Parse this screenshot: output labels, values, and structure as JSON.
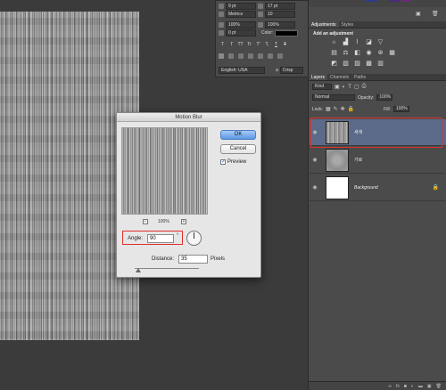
{
  "character_panel": {
    "font_size": "9 pt",
    "leading": "17 pt",
    "kerning": "Metrics",
    "tracking": "10",
    "vertical_scale": "100%",
    "horizontal_scale": "100%",
    "baseline_shift": "0 pt",
    "color_label": "Color:",
    "style_buttons": [
      "T",
      "T",
      "TT",
      "Tr",
      "T'",
      "T,",
      "T",
      "T"
    ],
    "language": "English: USA",
    "antialias_short": "a",
    "antialias": "Crisp"
  },
  "adjustments_panel": {
    "tabs": [
      "Adjustments",
      "Styles"
    ],
    "heading": "Add an adjustment"
  },
  "layers_panel": {
    "tabs": [
      "Layers",
      "Channels",
      "Paths"
    ],
    "kind": "Kind",
    "blend_mode": "Normal",
    "opacity_label": "Opacity:",
    "opacity_value": "100%",
    "lock_label": "Lock:",
    "fill_label": "Fill:",
    "fill_value": "100%",
    "layers": [
      {
        "name": "새색",
        "selected": true
      },
      {
        "name": "가로",
        "selected": false
      },
      {
        "name": "Background",
        "selected": false
      }
    ]
  },
  "motion_blur_dialog": {
    "title": "Motion Blur",
    "ok_label": "OK",
    "cancel_label": "Cancel",
    "preview_label": "Preview",
    "preview_checked": true,
    "zoom_out": "−",
    "zoom_level": "100%",
    "zoom_in": "+",
    "angle_label": "Angle:",
    "angle_value": "90",
    "degree_symbol": "°",
    "distance_label": "Distance:",
    "distance_value": "35",
    "distance_unit": "Pixels"
  }
}
